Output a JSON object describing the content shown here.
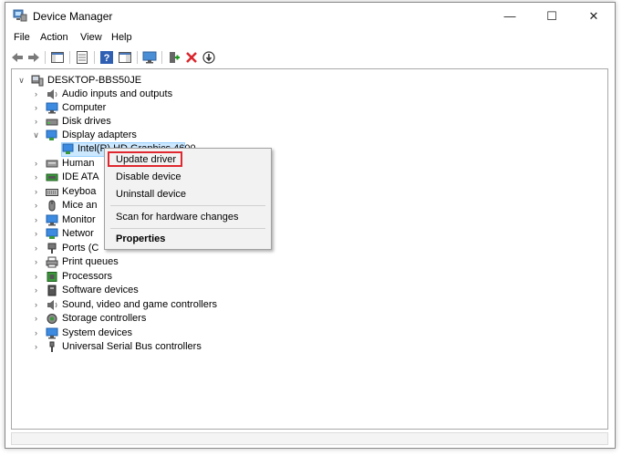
{
  "window": {
    "title": "Device Manager",
    "controls": {
      "minimize": "—",
      "maximize": "☐",
      "close": "✕"
    }
  },
  "menu": {
    "items": [
      "File",
      "Action",
      "View",
      "Help"
    ]
  },
  "toolbar": {
    "buttons": [
      "back-icon",
      "forward-icon",
      "properties-icon",
      "view-icon",
      "help-icon",
      "action-icon",
      "monitor-icon",
      "add-driver-icon",
      "uninstall-icon",
      "update-icon"
    ]
  },
  "tree": {
    "root": "DESKTOP-BBS50JE",
    "categories": [
      {
        "label": "Audio inputs and outputs",
        "icon": "speaker-icon",
        "expanded": false
      },
      {
        "label": "Computer",
        "icon": "computer-icon",
        "expanded": false
      },
      {
        "label": "Disk drives",
        "icon": "disk-icon",
        "expanded": false
      },
      {
        "label": "Display adapters",
        "icon": "display-adapter-icon",
        "expanded": true,
        "children": [
          {
            "label": "Intel(R) HD Graphics 4600",
            "icon": "display-adapter-icon",
            "selected": true
          }
        ]
      },
      {
        "label": "Human",
        "icon": "hid-icon",
        "expanded": false
      },
      {
        "label": "IDE ATA",
        "icon": "ide-icon",
        "expanded": false
      },
      {
        "label": "Keyboa",
        "icon": "keyboard-icon",
        "expanded": false
      },
      {
        "label": "Mice an",
        "icon": "mouse-icon",
        "expanded": false
      },
      {
        "label": "Monitor",
        "icon": "monitor-icon",
        "expanded": false
      },
      {
        "label": "Networ",
        "icon": "network-icon",
        "expanded": false
      },
      {
        "label": "Ports (C",
        "icon": "port-icon",
        "expanded": false
      },
      {
        "label": "Print queues",
        "icon": "printer-icon",
        "expanded": false
      },
      {
        "label": "Processors",
        "icon": "processor-icon",
        "expanded": false
      },
      {
        "label": "Software devices",
        "icon": "software-icon",
        "expanded": false
      },
      {
        "label": "Sound, video and game controllers",
        "icon": "sound-icon",
        "expanded": false
      },
      {
        "label": "Storage controllers",
        "icon": "storage-icon",
        "expanded": false
      },
      {
        "label": "System devices",
        "icon": "system-icon",
        "expanded": false
      },
      {
        "label": "Universal Serial Bus controllers",
        "icon": "usb-icon",
        "expanded": false
      }
    ]
  },
  "context_menu": {
    "items": [
      {
        "label": "Update driver",
        "highlighted": true
      },
      {
        "label": "Disable device"
      },
      {
        "label": "Uninstall device"
      },
      {
        "label": "Scan for hardware changes"
      },
      {
        "label": "Properties",
        "bold": true
      }
    ],
    "highlight_color": "#e0272f"
  },
  "colors": {
    "selection": "#cce8ff",
    "selection_border": "#99d1ff",
    "accent_red": "#e0272f"
  }
}
